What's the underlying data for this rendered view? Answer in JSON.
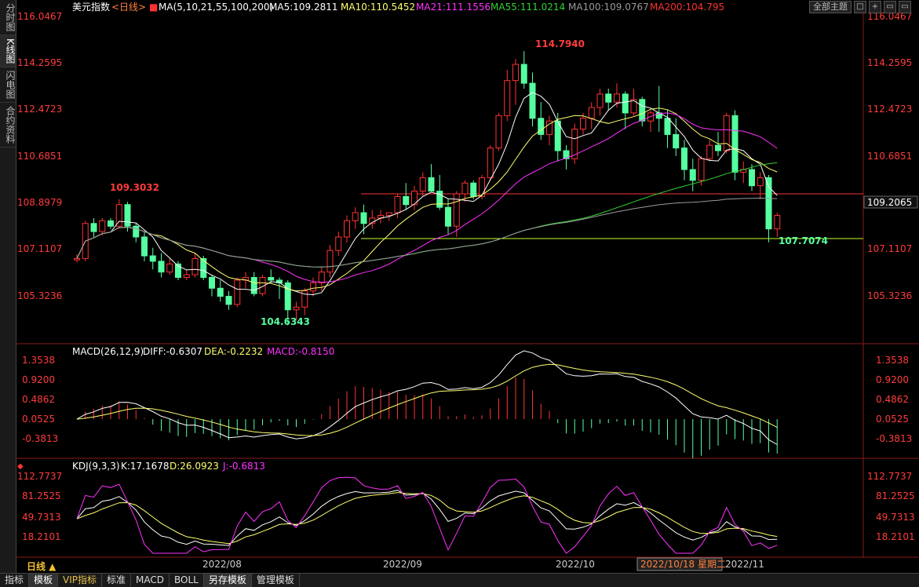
{
  "side_tabs": [
    "分时图",
    "K线图",
    "闪电图",
    "合约资料"
  ],
  "header": {
    "name": "美元指数",
    "period": "<日线>",
    "ma_label": "MA(5,10,21,55,100,200)",
    "ma5": "MA5:109.2811",
    "ma10": "MA10:110.5452",
    "ma21": "MA21:111.1556",
    "ma55": "MA55:111.0214",
    "ma100": "MA100:109.0767",
    "ma200": "MA200:104.795"
  },
  "toolbar": {
    "theme": "全部主题",
    "btn1": "□",
    "btn2": "+",
    "btn3": "▭",
    "btn4": "▭"
  },
  "colors": {
    "up": "#ff3232",
    "down": "#54ffa0",
    "ma5": "#ffffff",
    "ma10": "#ffff6e",
    "ma21": "#ff32ff",
    "ma55": "#32d232",
    "ma100": "#9a9a9a",
    "ma200": "#ff3232",
    "axis_text": "#ff3c3c",
    "grid": "#3a0000"
  },
  "price_axis": {
    "ticks": [
      "116.0467",
      "114.2595",
      "112.4723",
      "110.6851",
      "108.8979",
      "107.1107",
      "105.3236"
    ],
    "current_price": "109.2065"
  },
  "annotations": {
    "high_1": "109.3032",
    "low_1": "104.6343",
    "high_2": "114.7940",
    "low_2": "107.7074"
  },
  "macd": {
    "label": "MACD(26,12,9)",
    "diff": "DIFF:-0.6307",
    "dea": "DEA:-0.2232",
    "macd": "MACD:-0.8150",
    "ticks": [
      "1.3538",
      "0.9200",
      "0.4862",
      "0.0525",
      "-0.3813"
    ]
  },
  "kdj": {
    "label": "KDJ(9,3,3)",
    "k": "K:17.1678",
    "d": "D:26.0923",
    "j": "J:-0.6813",
    "ticks": [
      "112.7737",
      "81.2525",
      "49.7313",
      "18.2101"
    ]
  },
  "x_axis": {
    "labels": [
      "2022/08",
      "2022/09",
      "2022/10",
      "2022/11"
    ],
    "cursor_label": "2022/10/18 星期二"
  },
  "period_button": "日线 ▲",
  "bottom_tabs": [
    "指标",
    "模板",
    "VIP指标",
    "标准",
    "MACD",
    "BOLL",
    "另存模板",
    "管理模板"
  ],
  "chart_data": {
    "type": "candlestick",
    "title": "美元指数 <日线>",
    "ylim": [
      104.0,
      116.0467
    ],
    "candles": [
      [
        107.05,
        107.25,
        106.95,
        107.1
      ],
      [
        107.1,
        108.5,
        107.0,
        108.4
      ],
      [
        108.4,
        108.6,
        107.9,
        108.1
      ],
      [
        108.1,
        108.6,
        107.95,
        108.5
      ],
      [
        108.5,
        108.6,
        108.2,
        108.3
      ],
      [
        108.3,
        109.3,
        108.2,
        109.1
      ],
      [
        109.1,
        109.2,
        108.1,
        108.3
      ],
      [
        108.3,
        108.4,
        107.7,
        107.9
      ],
      [
        107.9,
        108.1,
        107.0,
        107.2
      ],
      [
        107.2,
        107.5,
        106.7,
        107.0
      ],
      [
        107.0,
        107.3,
        106.4,
        106.6
      ],
      [
        106.6,
        107.1,
        106.5,
        106.9
      ],
      [
        106.9,
        107.0,
        106.3,
        106.4
      ],
      [
        106.4,
        106.7,
        106.3,
        106.5
      ],
      [
        106.5,
        107.3,
        106.4,
        107.1
      ],
      [
        107.1,
        107.2,
        106.3,
        106.4
      ],
      [
        106.4,
        106.5,
        105.7,
        106.0
      ],
      [
        106.0,
        106.3,
        105.5,
        105.7
      ],
      [
        105.7,
        105.9,
        105.2,
        105.4
      ],
      [
        105.4,
        106.4,
        105.3,
        106.3
      ],
      [
        106.3,
        106.6,
        106.0,
        106.4
      ],
      [
        106.4,
        106.6,
        105.7,
        105.8
      ],
      [
        105.8,
        106.5,
        105.7,
        106.4
      ],
      [
        106.4,
        106.7,
        106.2,
        106.3
      ],
      [
        106.3,
        106.4,
        105.6,
        106.2
      ],
      [
        106.2,
        106.3,
        104.63,
        105.2
      ],
      [
        105.2,
        105.5,
        104.8,
        105.3
      ],
      [
        105.3,
        106.0,
        105.0,
        105.9
      ],
      [
        105.9,
        106.4,
        105.7,
        106.2
      ],
      [
        106.2,
        106.8,
        105.9,
        106.6
      ],
      [
        106.6,
        107.6,
        106.4,
        107.4
      ],
      [
        107.4,
        108.1,
        107.2,
        107.9
      ],
      [
        107.9,
        108.7,
        107.7,
        108.5
      ],
      [
        108.5,
        109.0,
        108.2,
        108.8
      ],
      [
        108.8,
        109.1,
        108.0,
        108.4
      ],
      [
        108.4,
        108.9,
        108.2,
        108.6
      ],
      [
        108.6,
        108.9,
        108.4,
        108.7
      ],
      [
        108.7,
        108.8,
        108.5,
        108.8
      ],
      [
        108.8,
        109.5,
        108.6,
        109.4
      ],
      [
        109.4,
        109.9,
        108.9,
        109.1
      ],
      [
        109.1,
        109.8,
        108.9,
        109.6
      ],
      [
        109.6,
        110.3,
        109.4,
        110.1
      ],
      [
        110.1,
        110.6,
        109.6,
        109.6
      ],
      [
        109.6,
        110.2,
        108.9,
        109.0
      ],
      [
        109.0,
        109.3,
        108.0,
        108.3
      ],
      [
        108.3,
        109.6,
        107.9,
        109.5
      ],
      [
        109.5,
        110.0,
        109.2,
        109.9
      ],
      [
        109.9,
        110.0,
        109.3,
        109.4
      ],
      [
        109.4,
        110.2,
        109.3,
        110.1
      ],
      [
        110.1,
        111.3,
        110.0,
        111.2
      ],
      [
        111.2,
        112.5,
        111.1,
        112.4
      ],
      [
        112.4,
        114.1,
        112.2,
        113.7
      ],
      [
        113.7,
        114.5,
        112.8,
        114.3
      ],
      [
        114.3,
        114.79,
        113.4,
        113.6
      ],
      [
        113.6,
        114.0,
        112.0,
        112.3
      ],
      [
        112.3,
        112.9,
        111.5,
        111.7
      ],
      [
        111.7,
        112.4,
        111.3,
        112.2
      ],
      [
        112.2,
        112.5,
        110.7,
        111.1
      ],
      [
        111.1,
        111.3,
        110.4,
        110.8
      ],
      [
        110.8,
        112.1,
        110.6,
        111.9
      ],
      [
        111.9,
        112.5,
        111.7,
        112.3
      ],
      [
        112.3,
        112.9,
        111.9,
        112.7
      ],
      [
        112.7,
        113.4,
        112.4,
        113.2
      ],
      [
        113.2,
        113.4,
        112.6,
        112.9
      ],
      [
        112.9,
        113.6,
        112.7,
        113.2
      ],
      [
        113.2,
        113.3,
        111.9,
        112.5
      ],
      [
        112.5,
        113.4,
        112.4,
        113.0
      ],
      [
        113.0,
        113.1,
        112.0,
        112.2
      ],
      [
        112.2,
        112.6,
        111.8,
        112.5
      ],
      [
        112.5,
        113.5,
        111.8,
        112.3
      ],
      [
        112.3,
        112.6,
        111.2,
        111.7
      ],
      [
        111.7,
        112.3,
        110.9,
        111.2
      ],
      [
        111.2,
        111.5,
        110.0,
        110.4
      ],
      [
        110.4,
        110.8,
        109.6,
        110.0
      ],
      [
        110.0,
        110.9,
        109.8,
        110.8
      ],
      [
        110.8,
        111.5,
        110.7,
        111.3
      ],
      [
        111.3,
        111.8,
        110.9,
        111.1
      ],
      [
        111.1,
        112.5,
        111.0,
        112.4
      ],
      [
        112.4,
        112.6,
        110.0,
        110.3
      ],
      [
        110.3,
        110.7,
        109.9,
        110.4
      ],
      [
        110.4,
        110.6,
        109.6,
        109.8
      ],
      [
        109.8,
        110.3,
        109.3,
        110.1
      ],
      [
        110.1,
        110.2,
        107.7,
        108.2
      ],
      [
        108.2,
        108.8,
        107.9,
        108.7
      ]
    ]
  }
}
